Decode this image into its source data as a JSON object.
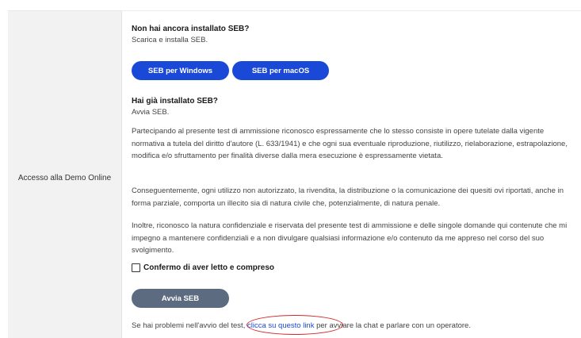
{
  "sidebar": {
    "label": "Accesso alla Demo Online"
  },
  "install": {
    "title": "Non hai ancora installato SEB?",
    "subtitle": "Scarica e installa SEB.",
    "windows_button": "SEB per Windows",
    "mac_button": "SEB per macOS"
  },
  "installed": {
    "title": "Hai già installato SEB?",
    "subtitle": "Avvia SEB."
  },
  "paragraphs": [
    "Partecipando al presente test di ammissione riconosco espressamente che lo stesso consiste in opere tutelate dalla vigente normativa a tutela del diritto d'autore (L. 633/1941) e che ogni sua eventuale riproduzione, riutilizzo, rielaborazione, estrapolazione, modifica e/o sfruttamento per finalità diverse dalla mera esecuzione è espressamente vietata.",
    "Conseguentemente, ogni utilizzo non autorizzato, la rivendita, la distribuzione o la comunicazione dei quesiti ovi riportati, anche in forma parziale, comporta un illecito sia di natura civile che, potenzialmente, di natura penale.",
    "Inoltre, riconosco la natura confidenziale e riservata del presente test di ammissione e delle singole domande qui contenute che mi impegno a mantenere confidenziali e a non divulgare qualsiasi informazione e/o contenuto da me appreso nel corso del suo svolgimento."
  ],
  "confirm": {
    "label": "Confermo di aver letto e compreso",
    "checked": false
  },
  "start_button": "Avvia SEB",
  "help": {
    "prefix": "Se hai problemi nell'avvio del test, ",
    "link": "clicca su questo link",
    "suffix": " per avviare la chat e parlare con un operatore."
  }
}
